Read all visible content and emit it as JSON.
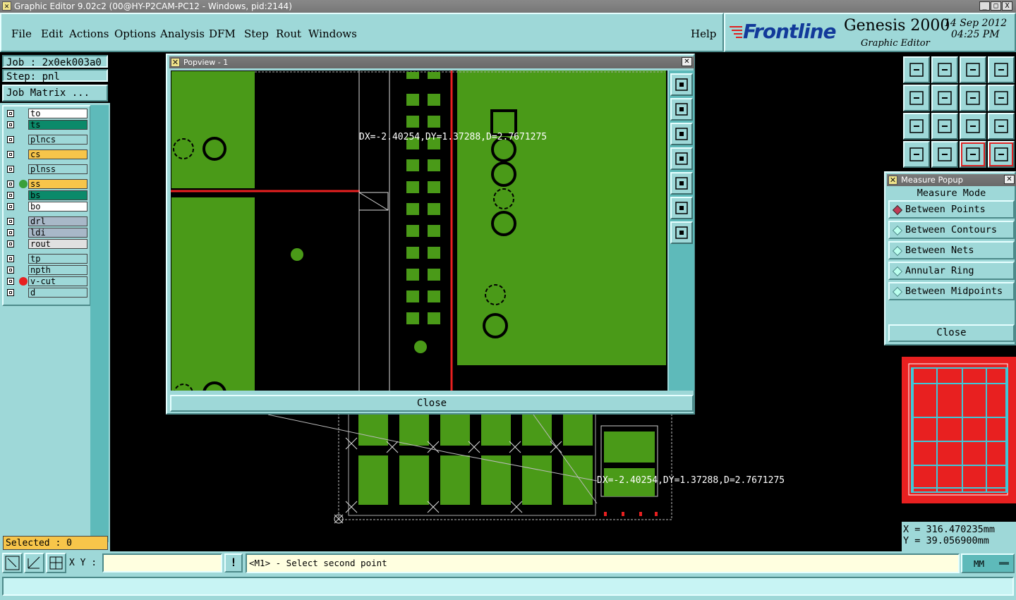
{
  "window": {
    "title": "Graphic Editor 9.02c2 (00@HY-P2CAM-PC12 - Windows, pid:2144)",
    "btn_min": "_",
    "btn_max": "□",
    "btn_close": "X"
  },
  "menu": {
    "file": "File",
    "edit": "Edit",
    "actions": "Actions",
    "options": "Options",
    "analysis": "Analysis",
    "dfm": "DFM",
    "step": "Step",
    "rout": "Rout",
    "windows": "Windows",
    "help": "Help"
  },
  "brand": {
    "logo": "Frontline",
    "product": "Genesis 2000",
    "subtitle": "Graphic Editor",
    "date": "14 Sep 2012",
    "time": "04:25 PM"
  },
  "job": {
    "job_label": "Job : 2x0ek003a0",
    "step_label": "Step: pnl",
    "matrix_button": "Job Matrix ..."
  },
  "layers": [
    {
      "name": "to",
      "color": "#ffffff",
      "dot": ""
    },
    {
      "name": "ts",
      "color": "#0b8a6a",
      "dot": ""
    },
    {
      "name": "plncs",
      "color": "#9ed8d8",
      "dot": ""
    },
    {
      "name": "cs",
      "color": "#f7c54a",
      "dot": ""
    },
    {
      "name": "plnss",
      "color": "#9ed8d8",
      "dot": ""
    },
    {
      "name": "ss",
      "color": "#f7c54a",
      "dot": "#3aa03a"
    },
    {
      "name": "bs",
      "color": "#0b8a6a",
      "dot": ""
    },
    {
      "name": "bo",
      "color": "#ffffff",
      "dot": ""
    },
    {
      "name": "drl",
      "color": "#a8b8c8",
      "dot": ""
    },
    {
      "name": "ldi",
      "color": "#a8b8c8",
      "dot": ""
    },
    {
      "name": "rout",
      "color": "#e0e0e0",
      "dot": ""
    },
    {
      "name": "tp",
      "color": "#9ed8d8",
      "dot": ""
    },
    {
      "name": "npth",
      "color": "#9ed8d8",
      "dot": ""
    },
    {
      "name": "v-cut",
      "color": "#9ed8d8",
      "dot": "#e82020"
    },
    {
      "name": "d",
      "color": "#9ed8d8",
      "dot": ""
    }
  ],
  "selected": "Selected : 0",
  "popview": {
    "title": "Popview - 1",
    "close_label": "Close",
    "measure_text": "DX=-2.40254,DY=1.37288,D=2.7671275"
  },
  "main_measure_text": "DX=-2.40254,DY=1.37288,D=2.7671275",
  "measure_popup": {
    "title": "Measure Popup",
    "mode_label": "Measure Mode",
    "options": [
      "Between Points",
      "Between Contours",
      "Between Nets",
      "Annular Ring",
      "Between Midpoints"
    ],
    "selected": "Between Points",
    "close_label": "Close"
  },
  "coords": {
    "x": "X = 316.470235mm",
    "y": "Y = 39.056900mm"
  },
  "cmdbar": {
    "xy_label": "X Y :",
    "xy_value": "",
    "prompt": "<M1> - Select second point",
    "units": "MM",
    "alert": "!"
  },
  "colors": {
    "panel": "#9ed8d8",
    "board_green": "#4a9a18",
    "cut_red": "#e82020"
  }
}
